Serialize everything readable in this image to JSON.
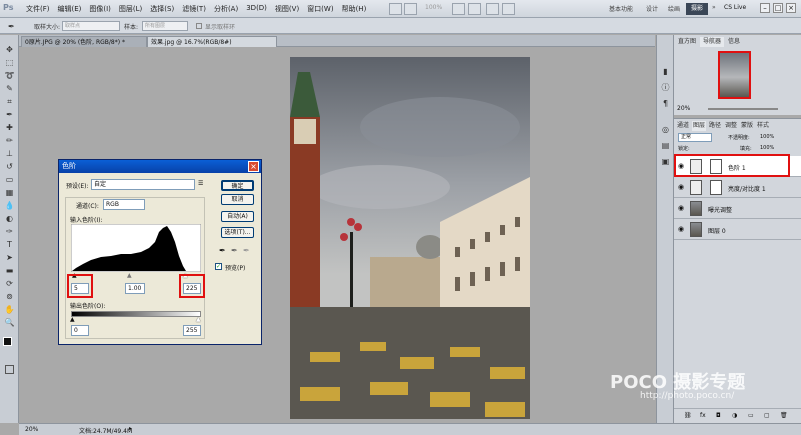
{
  "menubar": {
    "logo": "Ps",
    "items": [
      "文件(F)",
      "编辑(E)",
      "图像(I)",
      "图层(L)",
      "选择(S)",
      "滤镜(T)",
      "分析(A)",
      "3D(D)",
      "视图(V)",
      "窗口(W)",
      "帮助(H)"
    ],
    "zoom": "100%",
    "workspaces": [
      "基本功能",
      "设计",
      "绘画"
    ],
    "active_workspace": "摄影",
    "cs_live": "CS Live"
  },
  "options": {
    "sample_size_label": "取样大小:",
    "sample_size_value": "取样点",
    "sample_label": "样本:",
    "sample_value": "所有图层",
    "show_ring": "显示取样环"
  },
  "tabs": [
    {
      "label": "0原片.JPG @ 20% (色阶, RGB/8*) *",
      "active": false
    },
    {
      "label": "效果.jpg @ 16.7%(RGB/8#)",
      "active": true
    }
  ],
  "dialog": {
    "title": "色阶",
    "preset_label": "预设(E):",
    "preset_value": "自定",
    "channel_label": "通道(C):",
    "channel_value": "RGB",
    "input_label": "输入色阶(I):",
    "input_black": "5",
    "input_gamma": "1.00",
    "input_white": "225",
    "output_label": "输出色阶(O):",
    "output_black": "0",
    "output_white": "255",
    "buttons": {
      "ok": "确定",
      "cancel": "取消",
      "auto": "自动(A)",
      "options": "选项(T)..."
    },
    "preview": "预览(P)"
  },
  "right_panel": {
    "tabs_top": [
      "直方图",
      "导航器",
      "信息"
    ],
    "nav_zoom": "20%",
    "layer_tabs": [
      "通道",
      "图层",
      "路径",
      "调整",
      "蒙版",
      "样式"
    ],
    "blend_mode": "正常",
    "opacity_label": "不透明度:",
    "opacity": "100%",
    "lock_label": "锁定:",
    "fill_label": "填充:",
    "fill": "100%",
    "layers": [
      {
        "name": "色阶 1",
        "selected": true
      },
      {
        "name": "亮度/对比度 1",
        "selected": false
      },
      {
        "name": "曝光调整",
        "selected": false
      },
      {
        "name": "图层 0",
        "selected": false
      }
    ]
  },
  "status": {
    "zoom": "20%",
    "doc": "文档:24.7M/49.4M"
  },
  "watermark": {
    "brand": "POCO 摄影专题",
    "url": "http://photo.poco.cn/"
  },
  "colors": {
    "accent_red": "#e01010",
    "xp_blue": "#0a5fd6"
  }
}
